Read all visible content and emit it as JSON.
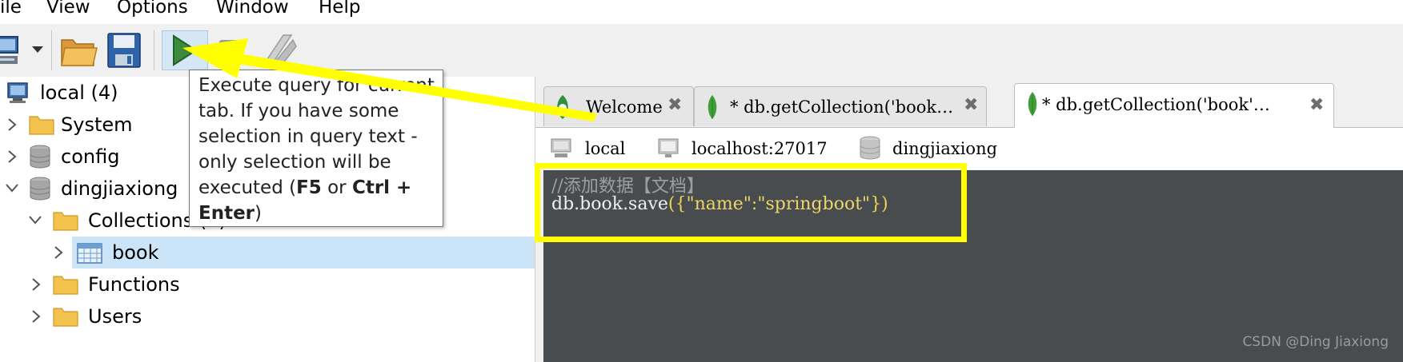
{
  "menu": {
    "items": [
      "ile",
      "View",
      "Options",
      "Window",
      "Help"
    ]
  },
  "toolbar": {
    "tooltip": {
      "prefix": "Execute query for current tab. If you have some selection in query text - only selection will be executed (",
      "key1": "F5",
      "middle": " or ",
      "key2": "Ctrl + Enter",
      "suffix": ")"
    }
  },
  "sidebar": {
    "connection_label": "local (4)",
    "system_label": "System",
    "config_label": "config",
    "db_label": "dingjiaxiong",
    "collections_label": "Collections (1)",
    "book_label": "book",
    "functions_label": "Functions",
    "users_label": "Users"
  },
  "tabs": [
    {
      "label": "Welcome"
    },
    {
      "label": "* db.getCollection('book…"
    },
    {
      "label": "* db.getCollection('book'…"
    }
  ],
  "breadcrumb": {
    "server": "local",
    "host": "localhost:27017",
    "database": "dingjiaxiong"
  },
  "editor": {
    "comment": "//添加数据【文档】",
    "code_prefix": "db.book.save",
    "code_brace_open": "({",
    "code_key": "\"name\"",
    "code_colon": ":",
    "code_value": "\"springboot\"",
    "code_brace_close": "})"
  },
  "watermark": "CSDN @Ding Jiaxiong",
  "colors": {
    "highlight": "#ffff00",
    "editor_bg": "#494c4f",
    "selection": "#cce4f7",
    "mongo_leaf": "#3fa037"
  }
}
